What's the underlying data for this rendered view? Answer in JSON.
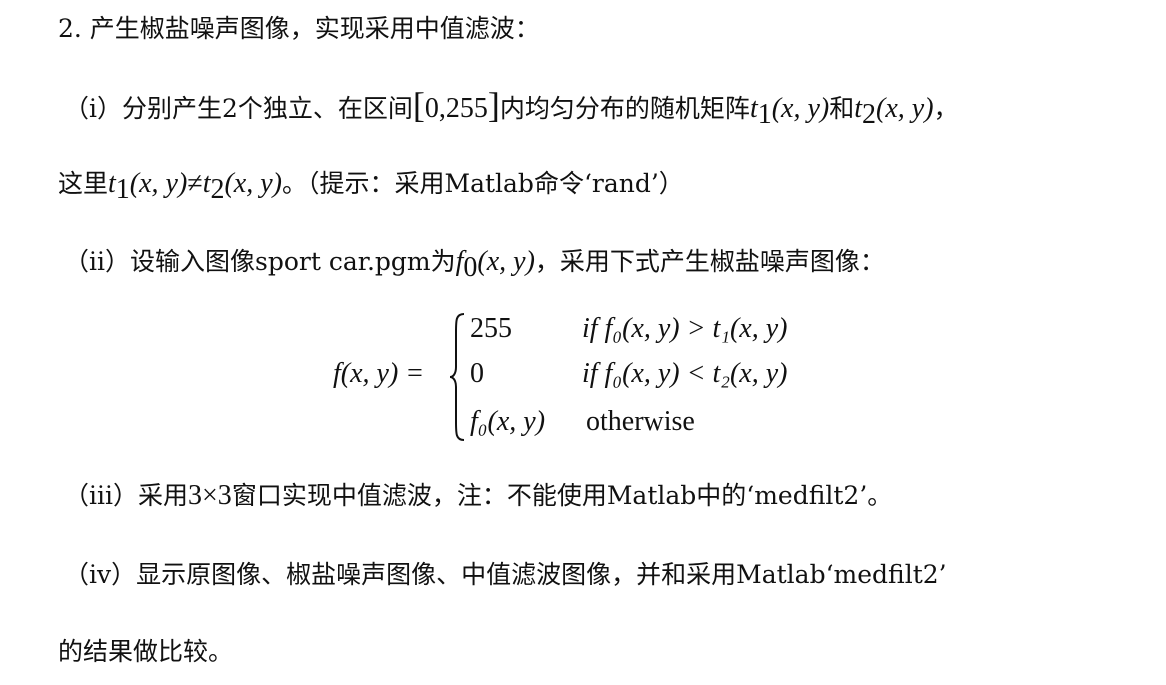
{
  "problem": {
    "heading": "2. 产生椒盐噪声图像，实现采用中值滤波：",
    "part1": {
      "label": "（i）",
      "text_a": "分别产生2个独立、在区间",
      "interval_open": "[",
      "interval": "0,255",
      "interval_close": "]",
      "text_b": "内均匀分布的随机矩阵",
      "t": "t",
      "sub1": "1",
      "sub2": "2",
      "args": "(x, y)",
      "and": "和",
      "comma": "，",
      "line2_start": "这里",
      "neq": "≠",
      "line2_end": "。（提示：采用Matlab命令‘rand’）"
    },
    "part2": {
      "label": "（ii）",
      "text_a": "设输入图像sport car.pgm为",
      "f": "f",
      "sub0": "0",
      "args": "(x, y)",
      "text_b": "，采用下式产生椒盐噪声图像："
    },
    "equation": {
      "lhs": "f(x, y) =",
      "case1_value": "255",
      "case1_cond": "if f₀(x, y) > t₁(x, y)",
      "case2_value": "0",
      "case2_cond": "if f₀(x, y) < t₂(x, y)",
      "case3_value": "f₀(x, y)",
      "case3_cond": "otherwise"
    },
    "part3": {
      "label": "（iii）",
      "text_a": "采用",
      "window": "3×3",
      "text_b": "窗口实现中值滤波，注：不能使用Matlab中的‘medfilt2’。"
    },
    "part4": {
      "label": "（iv）",
      "text": "显示原图像、椒盐噪声图像、中值滤波图像，并和采用Matlab‘medfilt2’",
      "line2": "的结果做比较。"
    }
  }
}
